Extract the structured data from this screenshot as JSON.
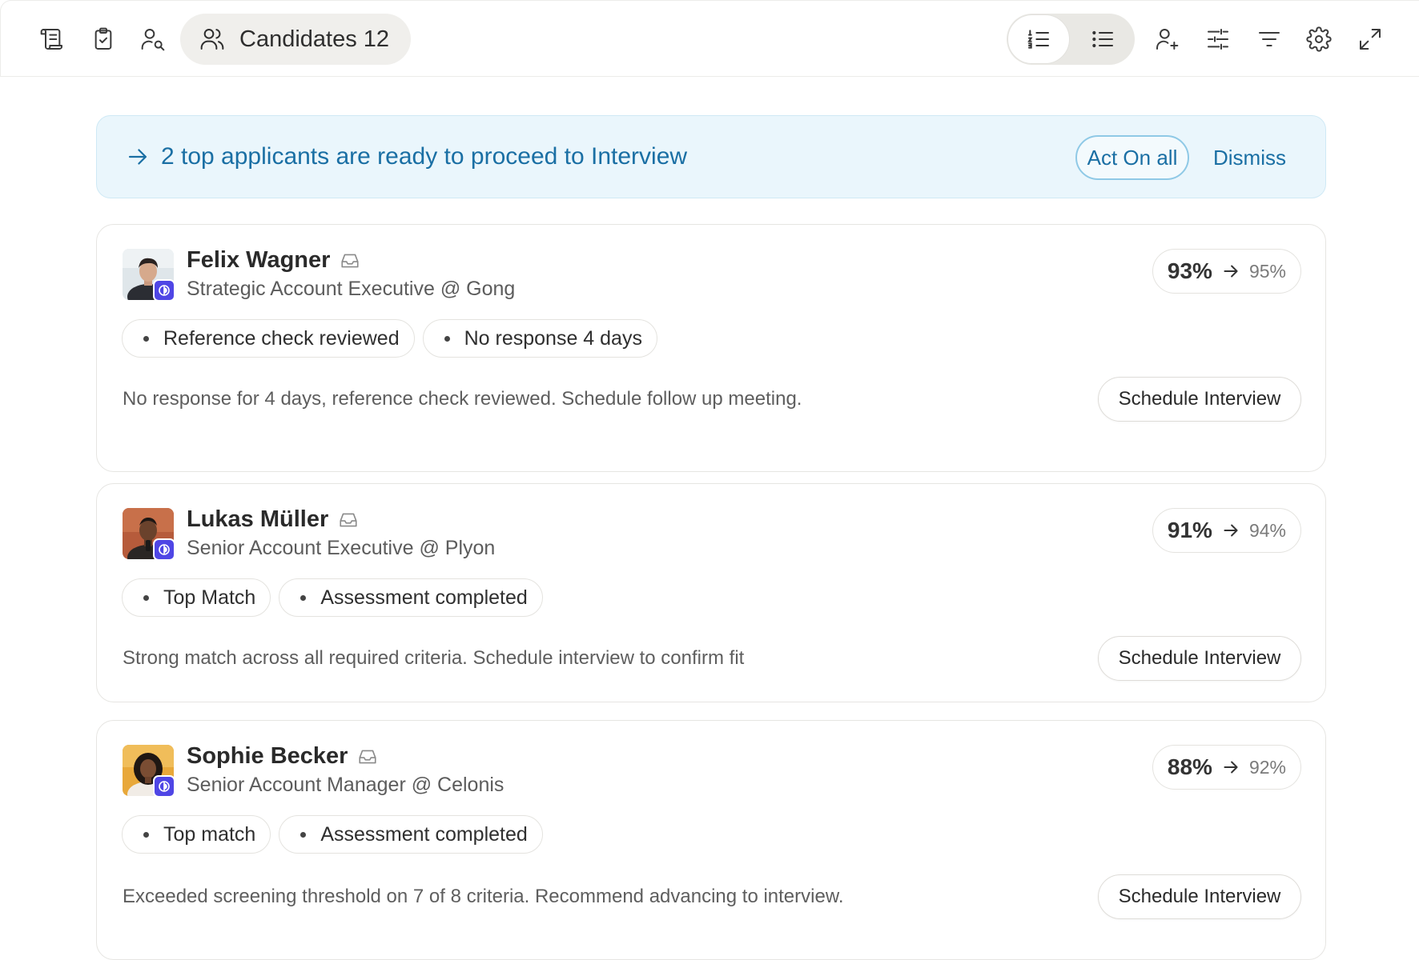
{
  "toolbar": {
    "left_icons": [
      "scroll-icon",
      "clipboard-check-icon",
      "user-search-icon"
    ],
    "candidates_label": "Candidates 12",
    "view_toggle": [
      "ordered-list-icon",
      "bulleted-list-icon"
    ],
    "right_icons": [
      "add-user-icon",
      "sliders-icon",
      "filter-icon",
      "gear-icon",
      "expand-icon"
    ]
  },
  "banner": {
    "text": "2 top applicants are ready to proceed to Interview",
    "act_label": "Act On all",
    "dismiss_label": "Dismiss",
    "color": "#1a6fa4",
    "background": "#eaf6fc"
  },
  "candidates": [
    {
      "name": "Felix Wagner",
      "role": "Strategic Account Executive @ Gong",
      "tags": [
        "Reference check reviewed",
        "No response 4 days"
      ],
      "summary": "No response for 4 days, reference check reviewed. Schedule follow up meeting.",
      "score_from": "93%",
      "score_to": "95%",
      "action_label": "Schedule Interview"
    },
    {
      "name": "Lukas Müller",
      "role": "Senior Account Executive @ Plyon",
      "tags": [
        "Top Match",
        "Assessment completed"
      ],
      "summary": "Strong match across all required criteria. Schedule interview to confirm fit",
      "score_from": "91%",
      "score_to": "94%",
      "action_label": "Schedule Interview"
    },
    {
      "name": "Sophie Becker",
      "role": "Senior Account Manager @ Celonis",
      "tags": [
        "Top match",
        "Assessment completed"
      ],
      "summary": "Exceeded screening threshold on 7 of 8 criteria. Recommend advancing to interview.",
      "score_from": "88%",
      "score_to": "92%",
      "action_label": "Schedule Interview"
    }
  ],
  "colors": {
    "badge": "#4f46e5",
    "pill_bg": "#f0efec"
  }
}
